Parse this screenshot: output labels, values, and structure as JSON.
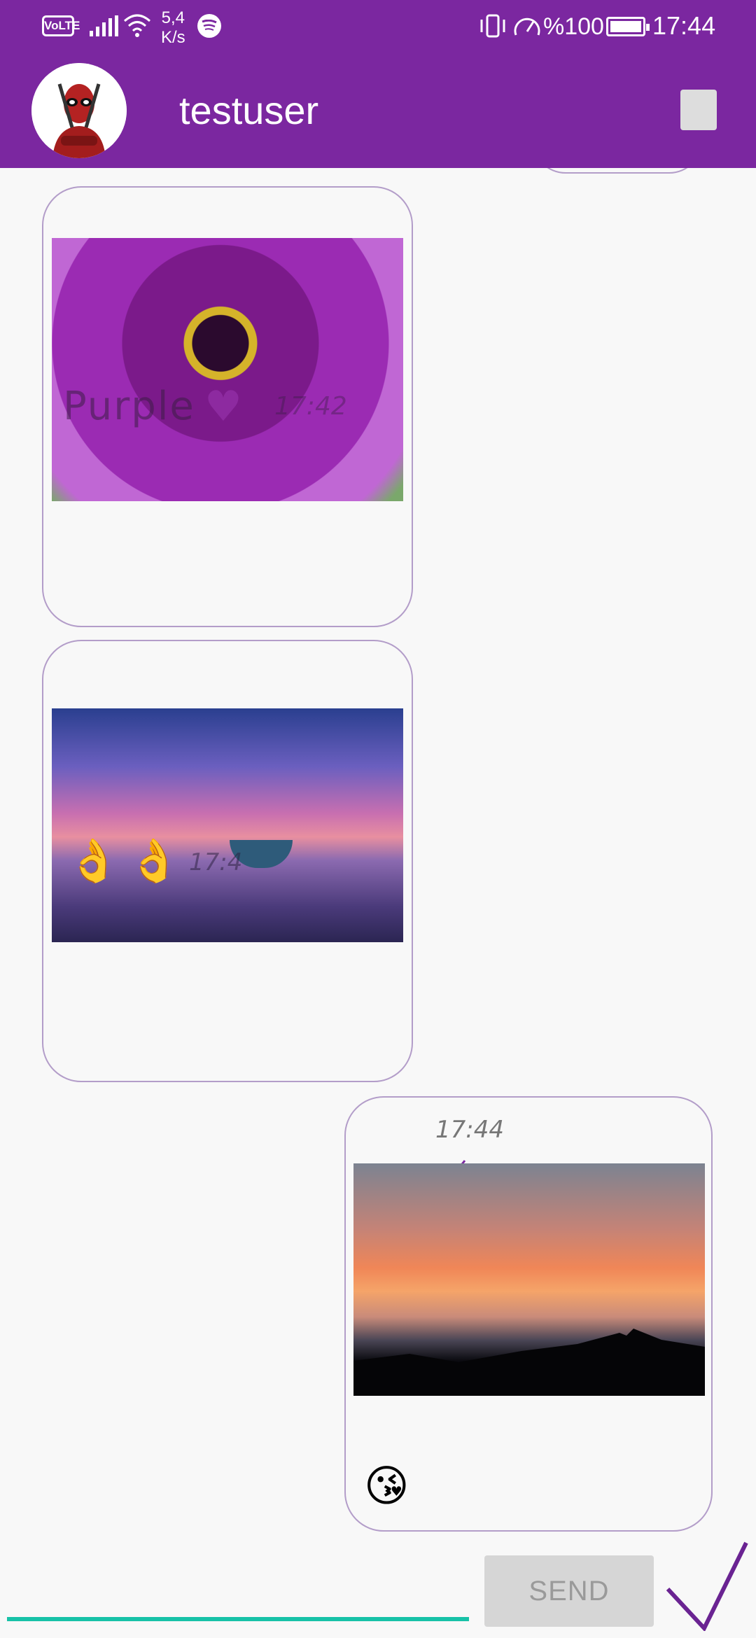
{
  "status_bar": {
    "volte": "VoLTE",
    "net_speed_value": "5,4",
    "net_speed_unit": "K/s",
    "battery_percent": "%100",
    "time": "17:44"
  },
  "header": {
    "username": "testuser"
  },
  "messages": [
    {
      "id": "m1",
      "side": "left",
      "image": "purple-flower",
      "text": "Purple",
      "emoji": "♥",
      "time": "17:42"
    },
    {
      "id": "m2",
      "side": "left",
      "image": "sunset-boat",
      "emoji": "👌👌",
      "time": "17:4"
    },
    {
      "id": "m3",
      "side": "right",
      "image": "sunset-mountain",
      "time": "17:44",
      "status_icon": "check-icon",
      "emoji": "😘"
    }
  ],
  "composer": {
    "input_value": "",
    "send_label": "SEND"
  },
  "colors": {
    "primary": "#7b27a0",
    "bubble_border": "#b39dc9",
    "input_underline": "#18c2a8"
  }
}
